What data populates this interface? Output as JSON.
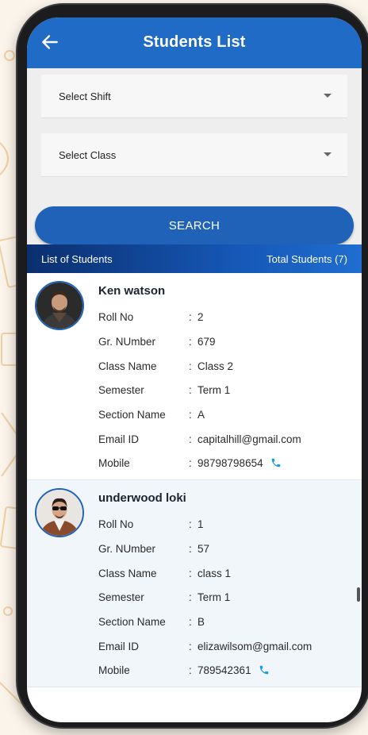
{
  "header": {
    "title": "Students List"
  },
  "filters": {
    "shift": {
      "label": "Select Shift"
    },
    "class": {
      "label": "Select Class"
    },
    "search_label": "SEARCH"
  },
  "list_header": {
    "left": "List of Students",
    "right": "Total Students (7)"
  },
  "field_labels": {
    "roll": "Roll No",
    "gr": "Gr. NUmber",
    "class": "Class Name",
    "semester": "Semester",
    "section": "Section Name",
    "email": "Email ID",
    "mobile": "Mobile"
  },
  "students": [
    {
      "name": "Ken watson",
      "roll": "2",
      "gr": "679",
      "class": "Class 2",
      "semester": "Term 1",
      "section": "A",
      "email": "capitalhill@gmail.com",
      "mobile": "98798798654"
    },
    {
      "name": "underwood loki",
      "roll": "1",
      "gr": "57",
      "class": "class 1",
      "semester": "Term 1",
      "section": "B",
      "email": "elizawilsom@gmail.com",
      "mobile": "789542361"
    }
  ],
  "colors": {
    "app_bar": "#1f6bc5",
    "search_button": "#1f62b8",
    "phone_icon": "#1a9be8",
    "header_gradient_start": "#0b2f6e"
  },
  "icons": {
    "back": "arrow-left-icon",
    "dropdown": "caret-down-icon",
    "call": "phone-icon"
  }
}
